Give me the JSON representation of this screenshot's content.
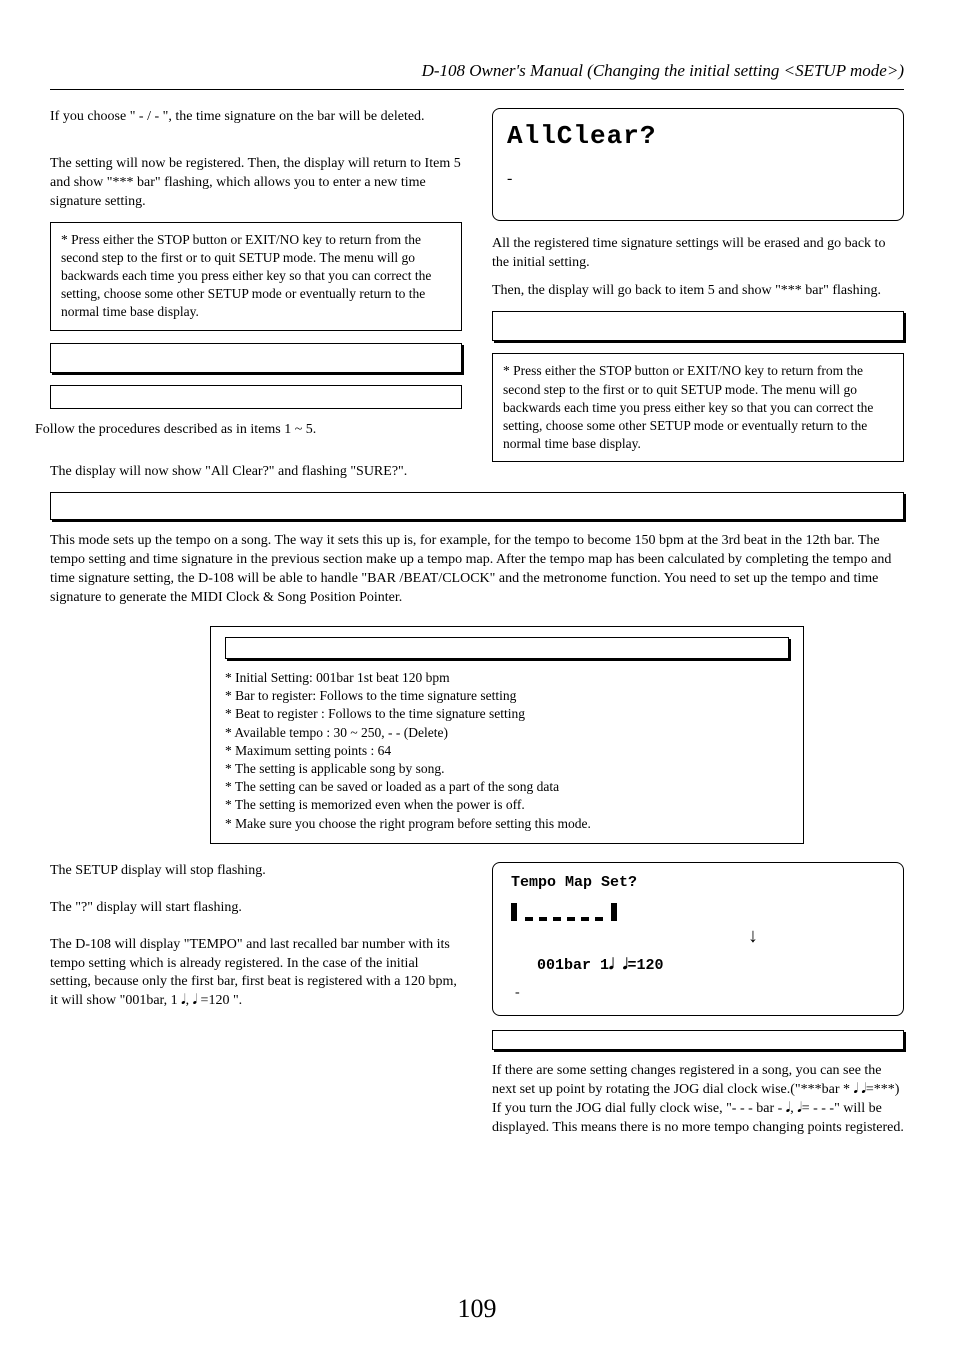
{
  "header": {
    "title": "D-108 Owner's Manual (Changing the initial setting <SETUP mode>)"
  },
  "left": {
    "p1": "If you choose \" - / - \", the time signature on the bar will be deleted.",
    "p2": "The setting will now be registered.  Then, the display will return to Item 5 and show \"*** bar\" flashing, which allows you to enter a new time signature setting.",
    "note": "* Press either the STOP button or EXIT/NO key to return from the second step to the first or to quit SETUP mode. The menu will go backwards each time you press either key so that you can correct the setting, choose some other SETUP mode or eventually return to the normal time base display.",
    "p3": "Follow the procedures described as in items 1 ~ 5.",
    "p4": "The display will now show \"All Clear?\" and flashing \"SURE?\"."
  },
  "right": {
    "lcd1": "AllClear?",
    "p1": "All the registered time signature settings will be erased and go back to the initial setting.",
    "p2": "Then, the display will go back to item 5 and show \"*** bar\" flashing.",
    "note": "* Press either the STOP button or EXIT/NO key to return from the second step to the first or to quit SETUP mode. The menu will go backwards each time you press either key so that you can correct the setting, choose some other SETUP mode or eventually return to the normal time base display."
  },
  "tempo": {
    "intro": "This mode sets up the tempo on a song.  The way it sets this up is, for example, for the tempo to become 150 bpm at the 3rd beat in the 12th bar.  The tempo setting and time signature in the previous section make up a tempo map.  After the tempo map has been calculated by completing the tempo and time signature setting, the D-108 will be able to handle \"BAR /BEAT/CLOCK\" and the metronome function.  You need to set up the tempo and time signature to generate the MIDI Clock & Song Position Pointer.",
    "bullets": {
      "b1": "* Initial Setting: 001bar 1st beat 120 bpm",
      "b2": "* Bar to register: Follows to the time signature setting",
      "b3": "* Beat to register : Follows to the time signature setting",
      "b4": "* Available tempo : 30 ~ 250, - - (Delete)",
      "b5": "* Maximum setting points : 64",
      "b6": "* The setting is applicable song by song.",
      "b7": "* The setting can be saved or loaded as a part of the song data",
      "b8": "* The setting is memorized even when the power is off.",
      "b9": "* Make sure you choose the right program before setting this mode."
    }
  },
  "lower_left": {
    "p1": "The SETUP display will stop flashing.",
    "p2": "The \"?\" display will start flashing.",
    "p3": "The D-108 will display \"TEMPO\" and last recalled bar number with its tempo setting which is already registered.  In the case of the initial setting, because only the first bar, first beat is registered with a 120 bpm, it will show \"001bar, 1 𝅘𝅥, 𝅘𝅥 =120 \"."
  },
  "lower_right": {
    "lcd_title": "Tempo Map Set?",
    "lcd_line": "001bar 1𝅘𝅥 𝅘𝅥=120",
    "p1": "If there are some setting changes registered in a song, you can see the next set up point by rotating the JOG dial clock wise.(\"***bar * 𝅘𝅥 𝅘𝅥=***)  If you turn the JOG dial fully clock wise, \"- - - bar  - 𝅘𝅥, 𝅘𝅥= - - -\" will be displayed. This means there is no more tempo changing points registered."
  },
  "page": "109"
}
